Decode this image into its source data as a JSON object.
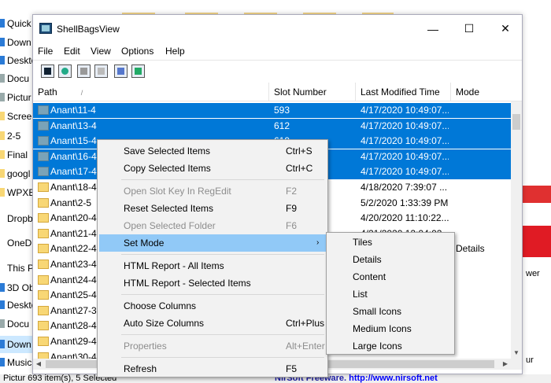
{
  "background": {
    "nav_items": [
      {
        "label": "Quick a",
        "icon": "star-icon",
        "color": "#2b7bd6"
      },
      {
        "label": "Down",
        "icon": "download-icon",
        "color": "#2b7bd6"
      },
      {
        "label": "Deskto",
        "icon": "desktop-icon",
        "color": "#2b7bd6"
      },
      {
        "label": "Docu",
        "icon": "document-icon",
        "color": "#9aa"
      },
      {
        "label": "Pictur",
        "icon": "picture-icon",
        "color": "#9aa"
      },
      {
        "label": "Screen",
        "icon": "folder-icon",
        "color": "#f8d775"
      },
      {
        "label": "2-5",
        "icon": "folder-icon",
        "color": "#f8d775"
      },
      {
        "label": "Final",
        "icon": "folder-icon",
        "color": "#f8d775"
      },
      {
        "label": "googl",
        "icon": "folder-icon",
        "color": "#f8d775"
      },
      {
        "label": "WPXB",
        "icon": "folder-icon",
        "color": "#f8d775"
      },
      {
        "label": "Dropbo",
        "icon": "dropbox-icon",
        "color": "#fff"
      },
      {
        "label": "OneDriv",
        "icon": "onedrive-icon",
        "color": "#fff"
      },
      {
        "label": "This PC",
        "icon": "pc-icon",
        "color": "#fff"
      },
      {
        "label": "3D Ob",
        "icon": "cube-icon",
        "color": "#2b7bd6"
      },
      {
        "label": "Deskto",
        "icon": "desktop-icon",
        "color": "#2b7bd6"
      },
      {
        "label": "Docu",
        "icon": "document-icon",
        "color": "#9aa"
      },
      {
        "label": "Down",
        "icon": "download-icon",
        "color": "#2b7bd6"
      },
      {
        "label": "Music",
        "icon": "music-icon",
        "color": "#2b7bd6"
      }
    ],
    "right_text_1": "wer",
    "right_text_2": "ur",
    "status_left": "Pictur  693 item(s), 5 Selected",
    "status_right_prefix": "NirSoft Freeware.  ",
    "status_right_link": "http://www.nirsoft.net"
  },
  "window": {
    "title": "ShellBagsView",
    "minimize": "—",
    "maximize": "☐",
    "close": "✕",
    "menu": [
      "File",
      "Edit",
      "View",
      "Options",
      "Help"
    ],
    "toolbar": [
      "save-icon",
      "refresh-icon",
      "copy-icon",
      "properties-icon",
      "find-icon",
      "exit-icon"
    ]
  },
  "list": {
    "columns": [
      "Path",
      "Slot Number",
      "Last Modified Time",
      "Mode"
    ],
    "sort_indicator": "/",
    "rows": [
      {
        "path": "Anant\\11-4",
        "slot": "593",
        "time": "4/17/2020 10:49:07...",
        "mode": "",
        "selected": true
      },
      {
        "path": "Anant\\13-4",
        "slot": "612",
        "time": "4/17/2020 10:49:07...",
        "mode": "",
        "selected": true
      },
      {
        "path": "Anant\\15-4",
        "slot": "619",
        "time": "4/17/2020 10:49:07...",
        "mode": "",
        "selected": true
      },
      {
        "path": "Anant\\16-4",
        "slot": "",
        "time": "4/17/2020 10:49:07...",
        "mode": "",
        "selected": true
      },
      {
        "path": "Anant\\17-4",
        "slot": "",
        "time": "4/17/2020 10:49:07...",
        "mode": "",
        "selected": true
      },
      {
        "path": "Anant\\18-4",
        "slot": "",
        "time": "4/18/2020 7:39:07 ...",
        "mode": "",
        "selected": false
      },
      {
        "path": "Anant\\2-5",
        "slot": "",
        "time": "5/2/2020 1:33:39 PM",
        "mode": "",
        "selected": false
      },
      {
        "path": "Anant\\20-4",
        "slot": "",
        "time": "4/20/2020 11:10:22...",
        "mode": "",
        "selected": false
      },
      {
        "path": "Anant\\21-4",
        "slot": "",
        "time": "4/21/2020 12:04:02...",
        "mode": "",
        "selected": false
      },
      {
        "path": "Anant\\22-4",
        "slot": "",
        "time": "",
        "mode": "Details",
        "selected": false
      },
      {
        "path": "Anant\\23-4",
        "slot": "",
        "time": "",
        "mode": "",
        "selected": false
      },
      {
        "path": "Anant\\24-4",
        "slot": "",
        "time": "",
        "mode": "",
        "selected": false
      },
      {
        "path": "Anant\\25-4",
        "slot": "",
        "time": "",
        "mode": "",
        "selected": false
      },
      {
        "path": "Anant\\27-3",
        "slot": "",
        "time": "",
        "mode": "",
        "selected": false
      },
      {
        "path": "Anant\\28-4",
        "slot": "",
        "time": "",
        "mode": "",
        "selected": false
      },
      {
        "path": "Anant\\29-4",
        "slot": "",
        "time": "",
        "mode": "",
        "selected": false
      },
      {
        "path": "Anant\\30-4",
        "slot": "",
        "time": "",
        "mode": "",
        "selected": false
      }
    ]
  },
  "context_menu": {
    "items": [
      {
        "label": "Save Selected Items",
        "key": "Ctrl+S",
        "disabled": false,
        "name": "save-selected-items"
      },
      {
        "label": "Copy Selected Items",
        "key": "Ctrl+C",
        "disabled": false,
        "name": "copy-selected-items"
      },
      {
        "sep": true
      },
      {
        "label": "Open Slot Key In RegEdit",
        "key": "F2",
        "disabled": true,
        "name": "open-slot-key"
      },
      {
        "label": "Reset Selected Items",
        "key": "F9",
        "disabled": false,
        "name": "reset-selected-items"
      },
      {
        "label": "Open Selected Folder",
        "key": "F6",
        "disabled": true,
        "name": "open-selected-folder"
      },
      {
        "label": "Set Mode",
        "key": "",
        "disabled": false,
        "name": "set-mode",
        "submenu": true,
        "highlighted": true
      },
      {
        "sep": true
      },
      {
        "label": "HTML Report - All Items",
        "key": "",
        "disabled": false,
        "name": "html-report-all"
      },
      {
        "label": "HTML Report - Selected Items",
        "key": "",
        "disabled": false,
        "name": "html-report-selected"
      },
      {
        "sep": true
      },
      {
        "label": "Choose Columns",
        "key": "",
        "disabled": false,
        "name": "choose-columns"
      },
      {
        "label": "Auto Size Columns",
        "key": "Ctrl+Plus",
        "disabled": false,
        "name": "auto-size-columns"
      },
      {
        "sep": true
      },
      {
        "label": "Properties",
        "key": "Alt+Enter",
        "disabled": true,
        "name": "properties"
      },
      {
        "sep": true
      },
      {
        "label": "Refresh",
        "key": "F5",
        "disabled": false,
        "name": "refresh"
      }
    ],
    "submenu_arrow": "›"
  },
  "submenu": {
    "items": [
      "Tiles",
      "Details",
      "Content",
      "List",
      "Small Icons",
      "Medium Icons",
      "Large Icons"
    ]
  },
  "colors": {
    "selection": "#0078d7",
    "menu_highlight": "#91c9f7"
  }
}
